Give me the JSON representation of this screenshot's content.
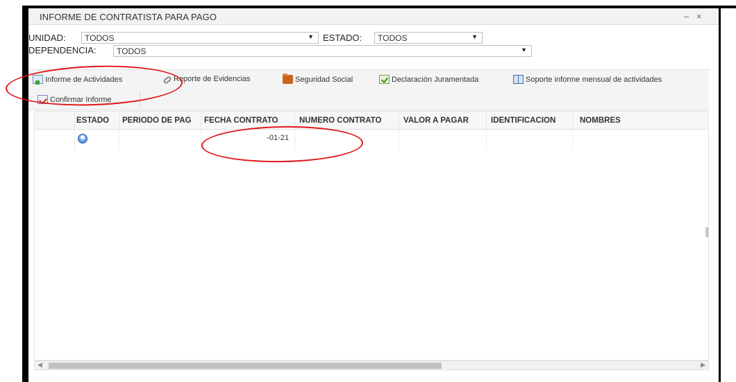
{
  "window": {
    "title": "INFORME DE CONTRATISTA PARA PAGO",
    "minimize_glyph": "–",
    "close_glyph": "×"
  },
  "filters": {
    "unidad_label": "UNIDAD:",
    "unidad_value": "TODOS",
    "estado_label": "ESTADO:",
    "estado_value": "TODOS",
    "dependencia_label": "DEPENDENCIA:",
    "dependencia_value": "TODOS",
    "dropdown_arrow": "▼"
  },
  "toolbar": {
    "buttons": [
      {
        "label": "Informe de Actividades",
        "icon": "document-add-icon"
      },
      {
        "label": "Reporte de Evidencias",
        "icon": "paperclip-icon"
      },
      {
        "label": "Seguridad Social",
        "icon": "folder-icon"
      },
      {
        "label": "Declaración Juramentada",
        "icon": "check-document-icon"
      },
      {
        "label": "Soporte informe mensual de actividades",
        "icon": "book-icon"
      },
      {
        "label": "Confirmar Informe",
        "icon": "confirm-icon"
      }
    ]
  },
  "grid": {
    "columns": [
      "ESTADO",
      "PERIODO DE PAG",
      "FECHA CONTRATO",
      "NUMERO CONTRATO",
      "VALOR A PAGAR",
      "IDENTIFICACION",
      "NOMBRES"
    ],
    "rows": [
      {
        "estado_icon": "status-circle-icon",
        "periodo": "",
        "fecha_contrato": "-01-21",
        "numero_contrato": "",
        "valor": "",
        "identificacion": "",
        "nombres": ""
      }
    ]
  },
  "scrollbar": {
    "left_arrow": "◀",
    "right_arrow": "▶"
  },
  "colors": {
    "annotation": "#e0161b",
    "status_icon": "#2f6fc4"
  }
}
